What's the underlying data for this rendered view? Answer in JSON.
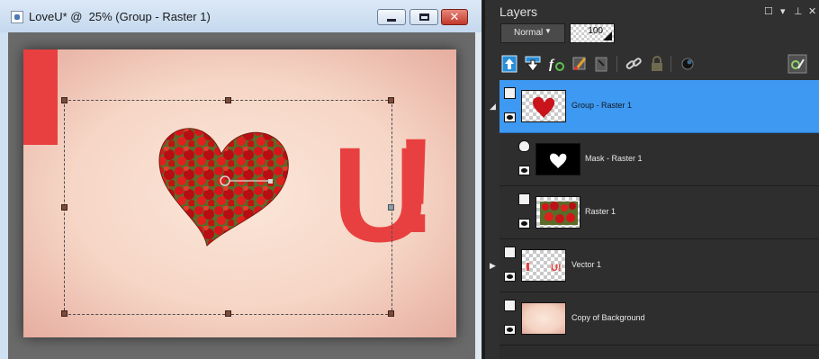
{
  "document_window": {
    "title": "LoveU* @  25% (Group - Raster 1)",
    "image": {
      "letter_left": "I",
      "letter_right": "U",
      "exclamation": "!",
      "text_color": "#e84040"
    }
  },
  "layers_panel": {
    "title": "Layers",
    "controls": {
      "undock": "☐",
      "menu": "▾",
      "pin": "⊥",
      "close": "✕"
    },
    "blend_mode": "Normal",
    "opacity": "100",
    "toolbar": [
      "new-raster-layer-icon",
      "new-vector-layer-icon",
      "layer-effects-icon",
      "edit-properties-icon",
      "delete-layer-icon",
      "link-icon",
      "lock-icon",
      "adjustment-icon",
      "highlight-icon"
    ],
    "layers": [
      {
        "name": "Group - Raster 1",
        "type": "group",
        "selected": true,
        "expanded": true
      },
      {
        "name": "Mask - Raster 1",
        "type": "mask",
        "selected": false
      },
      {
        "name": "Raster 1",
        "type": "raster",
        "selected": false
      },
      {
        "name": "Vector 1",
        "type": "vector",
        "selected": false,
        "expanded": false
      },
      {
        "name": "Copy of Background",
        "type": "raster",
        "selected": false
      }
    ],
    "selection_color": "#3e99f2"
  }
}
